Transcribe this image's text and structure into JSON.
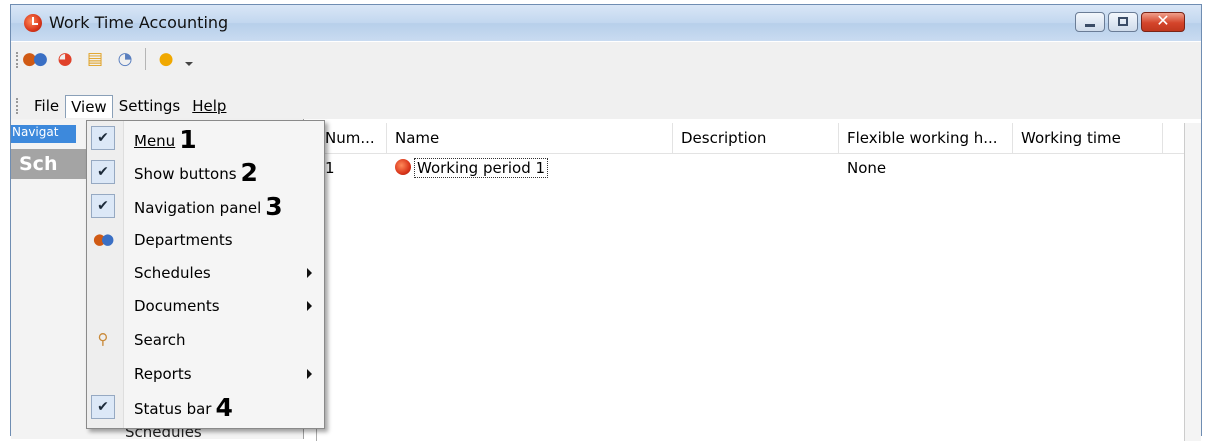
{
  "window": {
    "title": "Work Time Accounting"
  },
  "toolbar": {
    "icons": [
      "departments-icon",
      "schedules-icon",
      "documents-icon",
      "reports-icon",
      "feedback-icon"
    ]
  },
  "menubar": {
    "items": [
      "File",
      "View",
      "Settings",
      "Help"
    ]
  },
  "nav": {
    "header": "Navigat",
    "title": "Sch",
    "bottom_item": "Schedules"
  },
  "grid": {
    "columns": [
      "Num...",
      "Name",
      "Description",
      "Flexible working h...",
      "Working time"
    ],
    "rows": [
      {
        "num": "1",
        "name": "Working period 1",
        "description": "",
        "flexible": "None",
        "working_time": ""
      }
    ]
  },
  "view_menu": {
    "items": [
      {
        "label": "Menu",
        "checked": true,
        "number": "1"
      },
      {
        "label": "Show buttons",
        "checked": true,
        "number": "2"
      },
      {
        "label": "Navigation panel",
        "checked": true,
        "number": "3"
      },
      {
        "label": "Departments",
        "icon": "departments-icon"
      },
      {
        "label": "Schedules",
        "submenu": true
      },
      {
        "label": "Documents",
        "submenu": true
      },
      {
        "label": "Search",
        "icon": "search-icon"
      },
      {
        "label": "Reports",
        "submenu": true
      },
      {
        "label": "Status bar",
        "checked": true,
        "number": "4"
      }
    ]
  }
}
